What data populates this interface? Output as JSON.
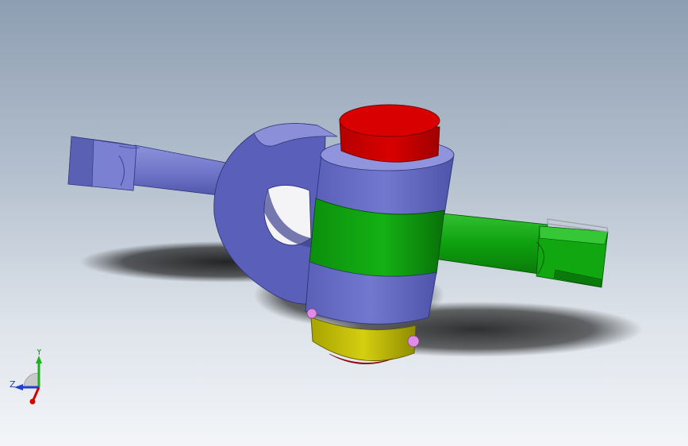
{
  "viewport": {
    "colors": {
      "shaft_blue": "#6f74c8",
      "shaft_blue_dark": "#4f55a8",
      "shaft_blue_light": "#8d92db",
      "green": "#0ea10e",
      "green_dark": "#0a7a0a",
      "red": "#d10000",
      "red_dark": "#a10000",
      "yellow": "#c7c200",
      "pin_pink": "#e08be6",
      "shadow": "#1b1b1b"
    }
  },
  "triad": {
    "x_label": "",
    "y_label": "Y",
    "z_label": "Z",
    "colors": {
      "x": "#d40000",
      "y": "#1fb01f",
      "z": "#1f3fd0"
    }
  }
}
